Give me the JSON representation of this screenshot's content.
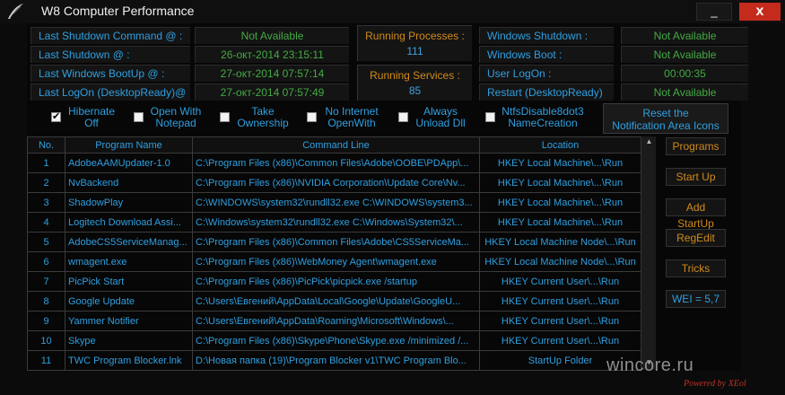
{
  "title": "W8 Computer Performance",
  "controls": {
    "minimize": "_",
    "close": "x"
  },
  "info": {
    "labels": [
      "Last Shutdown Command @ :",
      "Last Shutdown @ :",
      "Last Windows BootUp @ :",
      "Last LogOn (DesktopReady)@"
    ],
    "values": [
      "Not Available",
      "26-окт-2014 23:15:11",
      "27-окт-2014 07:57:14",
      "27-окт-2014 07:57:49"
    ],
    "running_processes": {
      "label": "Running Processes :",
      "value": "111"
    },
    "running_services": {
      "label": "Running Services :",
      "value": "85"
    },
    "right_labels": [
      "Windows Shutdown :",
      "Windows Boot :",
      "User LogOn :",
      "Restart (DesktopReady)"
    ],
    "right_values": [
      "Not Available",
      "Not Available",
      "00:00:35",
      "Not Available"
    ]
  },
  "options": [
    {
      "l1": "Hibernate",
      "l2": "Off",
      "checked": true
    },
    {
      "l1": "Open With",
      "l2": "Notepad",
      "checked": false
    },
    {
      "l1": "Take",
      "l2": "Ownership",
      "checked": false
    },
    {
      "l1": "No Internet",
      "l2": "OpenWith",
      "checked": false
    },
    {
      "l1": "Always",
      "l2": "Unload Dll",
      "checked": false
    },
    {
      "l1": "NtfsDisable8dot3",
      "l2": "NameCreation",
      "checked": false
    }
  ],
  "reset_button": {
    "l1": "Reset the",
    "l2": "Notification Area Icons"
  },
  "table": {
    "headers": [
      "No.",
      "Program   Name",
      "Command Line",
      "Location"
    ],
    "rows": [
      [
        "1",
        "AdobeAAMUpdater-1.0",
        "C:\\Program Files (x86)\\Common Files\\Adobe\\OOBE\\PDApp\\...",
        "HKEY Local Machine\\...\\Run"
      ],
      [
        "2",
        "NvBackend",
        "C:\\Program Files (x86)\\NVIDIA Corporation\\Update Core\\Nv...",
        "HKEY Local Machine\\...\\Run"
      ],
      [
        "3",
        "ShadowPlay",
        "C:\\WINDOWS\\system32\\rundll32.exe C:\\WINDOWS\\system3...",
        "HKEY Local Machine\\...\\Run"
      ],
      [
        "4",
        "Logitech Download Assi...",
        "C:\\Windows\\system32\\rundll32.exe C:\\Windows\\System32\\...",
        "HKEY Local Machine\\...\\Run"
      ],
      [
        "5",
        "AdobeCS5ServiceManag...",
        "C:\\Program Files (x86)\\Common Files\\Adobe\\CS5ServiceMa...",
        "HKEY Local Machine Node\\...\\Run"
      ],
      [
        "6",
        "wmagent.exe",
        "C:\\Program Files (x86)\\WebMoney Agent\\wmagent.exe",
        "HKEY Local Machine Node\\...\\Run"
      ],
      [
        "7",
        "PicPick Start",
        "C:\\Program Files (x86)\\PicPick\\picpick.exe /startup",
        "HKEY Current User\\...\\Run"
      ],
      [
        "8",
        "Google Update",
        "C:\\Users\\Евгений\\AppData\\Local\\Google\\Update\\GoogleU...",
        "HKEY Current User\\...\\Run"
      ],
      [
        "9",
        "Yammer Notifier",
        "C:\\Users\\Евгений\\AppData\\Roaming\\Microsoft\\Windows\\...",
        "HKEY Current User\\...\\Run"
      ],
      [
        "10",
        "Skype",
        "C:\\Program Files (x86)\\Skype\\Phone\\Skype.exe /minimized /...",
        "HKEY Current User\\...\\Run"
      ],
      [
        "11",
        "TWC Program Blocker.lnk",
        "D:\\Новая папка (19)\\Program Blocker v1\\TWC Program Blo...",
        "StartUp Folder"
      ]
    ]
  },
  "side_buttons": [
    "Programs",
    "Start Up",
    "Add StartUp",
    "RegEdit",
    "Tricks",
    "WEI = 5,7"
  ],
  "colors": {
    "accent": "#2f9fe0",
    "value_green": "#44aa44",
    "orange": "#d08a1a",
    "close_red": "#c42b1c"
  },
  "watermark": "wincore.ru",
  "powered_by": "Powered by XEol"
}
